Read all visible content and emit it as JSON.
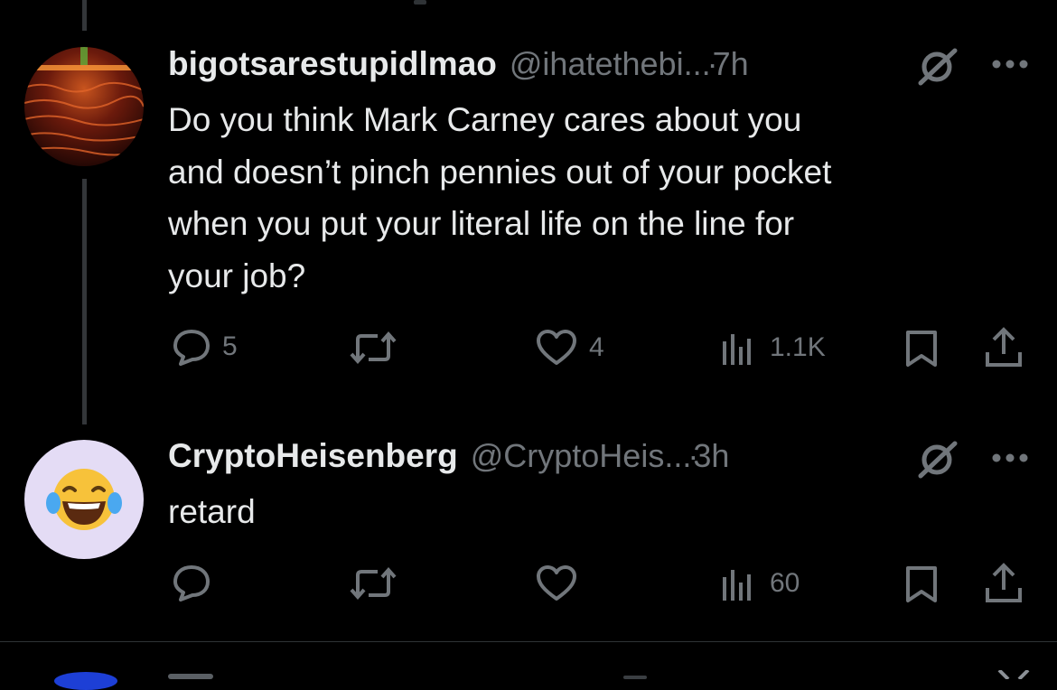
{
  "tweets": [
    {
      "display_name": "bigotsarestupidlmao",
      "handle": "@ihatethebi...",
      "sep": " · ",
      "time": "7h",
      "text_lines": [
        "Do you think Mark Carney cares about you",
        "and doesn’t pinch pennies out of your pocket",
        "when you put your literal life on the line for",
        "your job?"
      ],
      "actions": {
        "replies": "5",
        "retweets": "",
        "likes": "4",
        "views": "1.1K"
      }
    },
    {
      "display_name": "CryptoHeisenberg",
      "handle": "@CryptoHeis...",
      "sep": " · ",
      "time": "3h",
      "text_lines": [
        "retard"
      ],
      "actions": {
        "replies": "",
        "retweets": "",
        "likes": "",
        "views": "60"
      }
    }
  ],
  "icons": {
    "reply": "speech-bubble-icon",
    "retweet": "retweet-arrows-icon",
    "like": "heart-icon",
    "views": "bar-chart-icon",
    "bookmark": "bookmark-icon",
    "share": "share-upload-icon",
    "grok": "grok-slash-circle-icon",
    "more": "more-dots-icon"
  },
  "colors": {
    "background": "#000000",
    "text": "#e7e9ea",
    "muted": "#71767b",
    "thread_line": "#333639"
  }
}
